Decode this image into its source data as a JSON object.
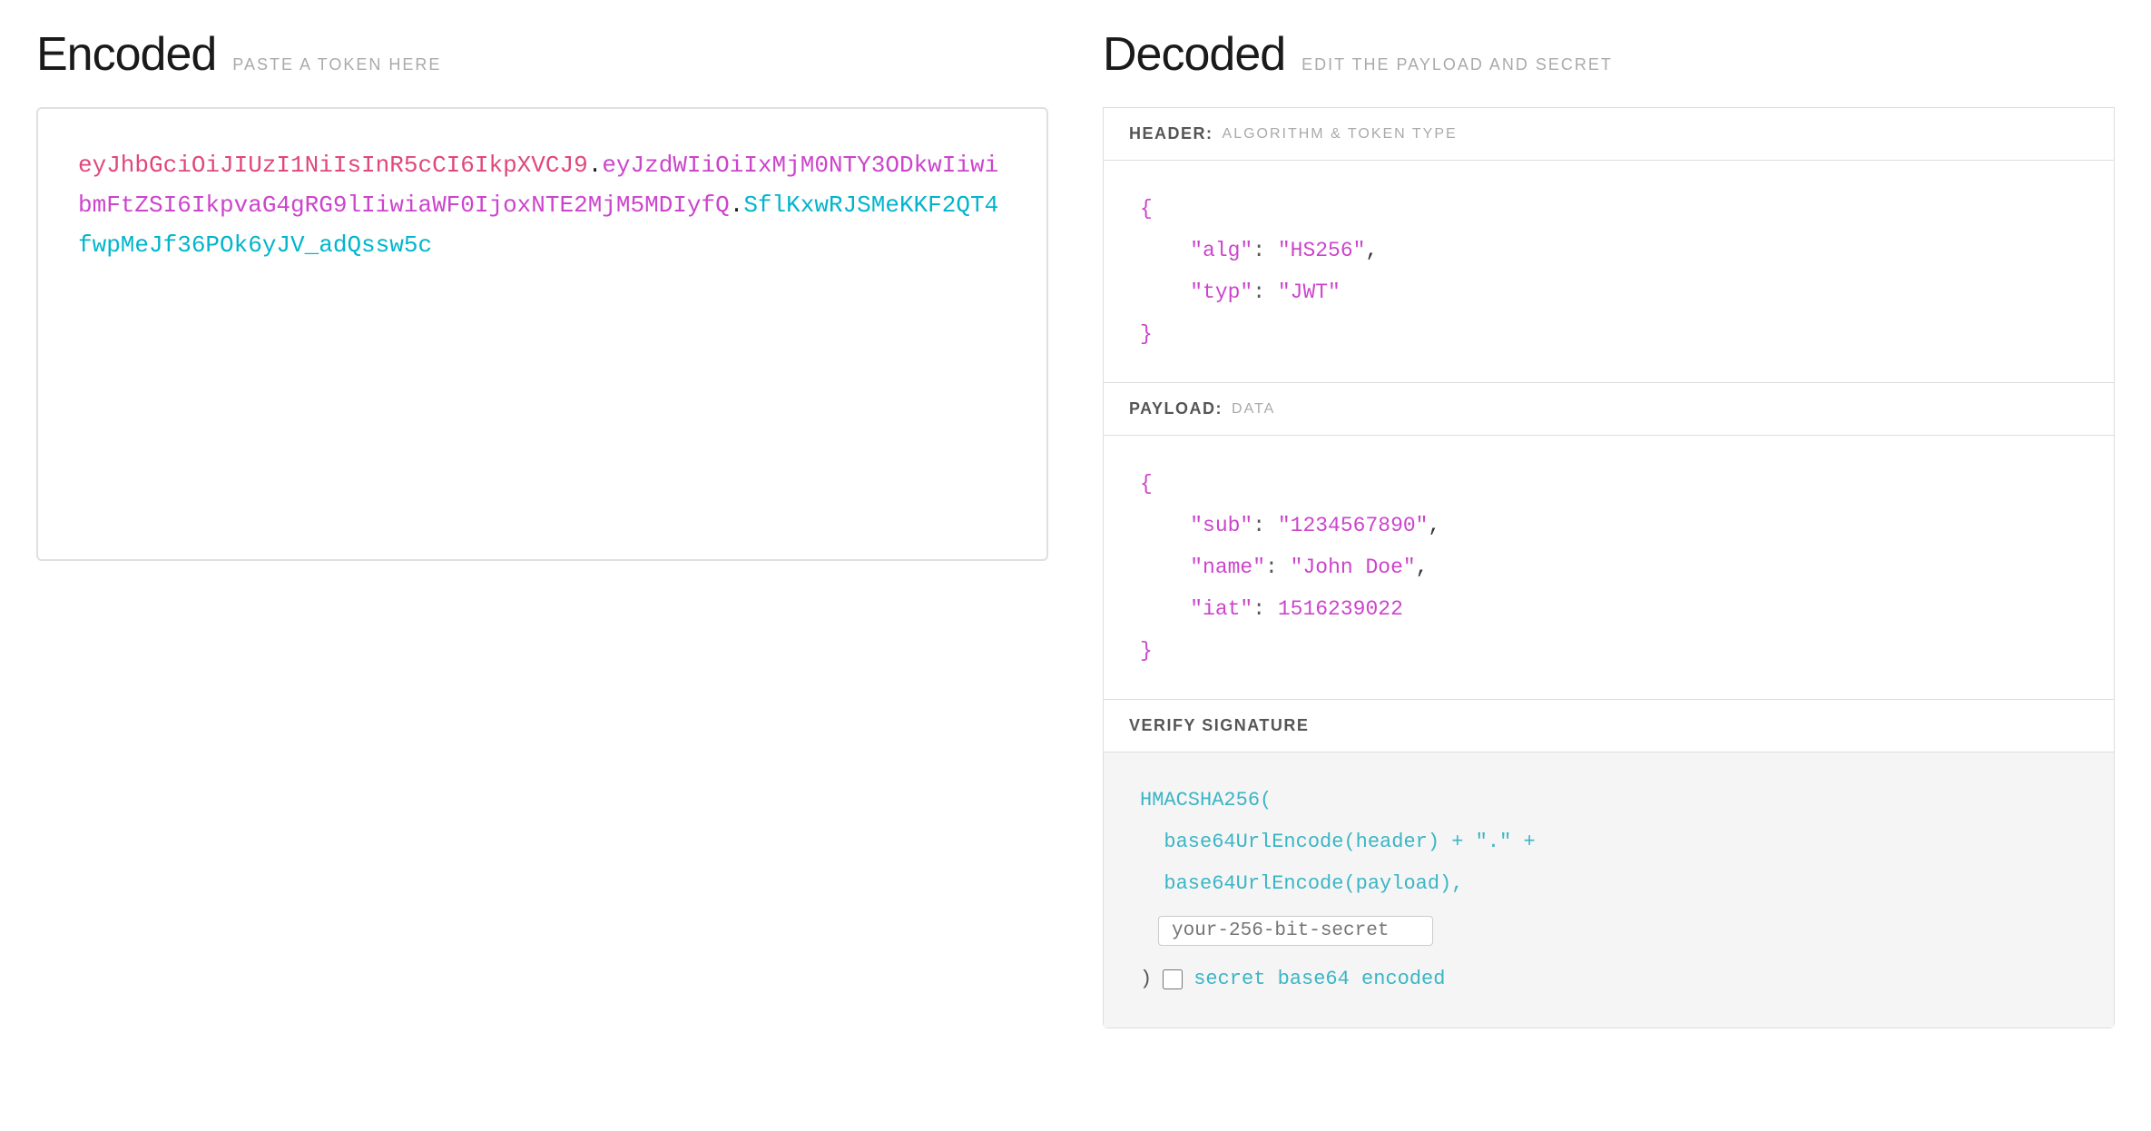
{
  "encoded": {
    "title": "Encoded",
    "subtitle": "PASTE A TOKEN HERE",
    "token": {
      "part1": "eyJhbGciOiJIUzI1NiIsInR5cCI6IkpXVCJ9",
      "dot1": ".",
      "part2": "eyJzdWIiOiIxMjM0NTY3ODkwIiwibmFtZSI6IkpvaG4gRG9lIiwiaWF0IjoxNTE2MjM5MDIyfQ",
      "dot2": ".",
      "part3": "SflKxwRJSMeKKF2QT4fwpMeJf36POk6yJV_adQssw5c"
    }
  },
  "decoded": {
    "title": "Decoded",
    "subtitle": "EDIT THE PAYLOAD AND SECRET",
    "header": {
      "label": "HEADER:",
      "sublabel": "ALGORITHM & TOKEN TYPE",
      "json": {
        "alg": "HS256",
        "typ": "JWT"
      }
    },
    "payload": {
      "label": "PAYLOAD:",
      "sublabel": "DATA",
      "json": {
        "sub": "1234567890",
        "name": "John Doe",
        "iat": 1516239022
      }
    },
    "verify": {
      "label": "VERIFY SIGNATURE",
      "func": "HMACSHA256(",
      "line1": "base64UrlEncode(header) + \".\" +",
      "line2": "base64UrlEncode(payload),",
      "secret_placeholder": "your-256-bit-secret",
      "close": ")",
      "checkbox_label": "secret base64 encoded"
    }
  }
}
